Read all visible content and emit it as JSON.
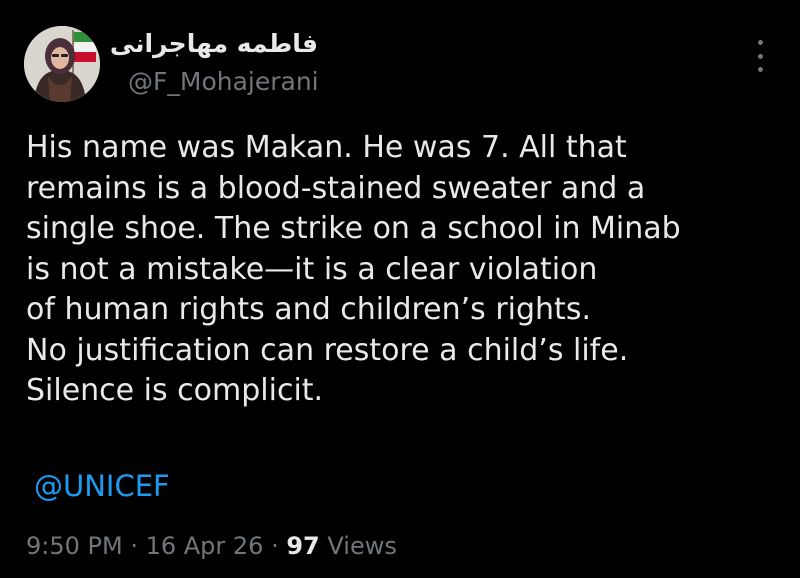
{
  "author": {
    "display_name": "فاطمه مهاجرانی",
    "handle": "@F_Mohajerani",
    "avatar_icon": "profile-photo-woman-hijab-flag"
  },
  "tweet": {
    "lines": [
      "His name was Makan. He was 7. All that",
      "remains is a blood-stained sweater and a",
      "single shoe. The strike on a school in Minab",
      "is not a mistake—it is a clear violation",
      "of human rights and children’s rights.",
      "No justification can restore a child’s life.",
      "Silence is complicit."
    ],
    "mention": "@UNICEF"
  },
  "meta": {
    "time": "9:50 PM",
    "separator": " · ",
    "date": "16 Apr 26",
    "views_count": "97",
    "views_label": " Views"
  },
  "menu_icon": "more-vertical-icon",
  "colors": {
    "background": "#000000",
    "text": "#e7e9ea",
    "secondary": "#71767b",
    "link": "#1d9bf0"
  }
}
